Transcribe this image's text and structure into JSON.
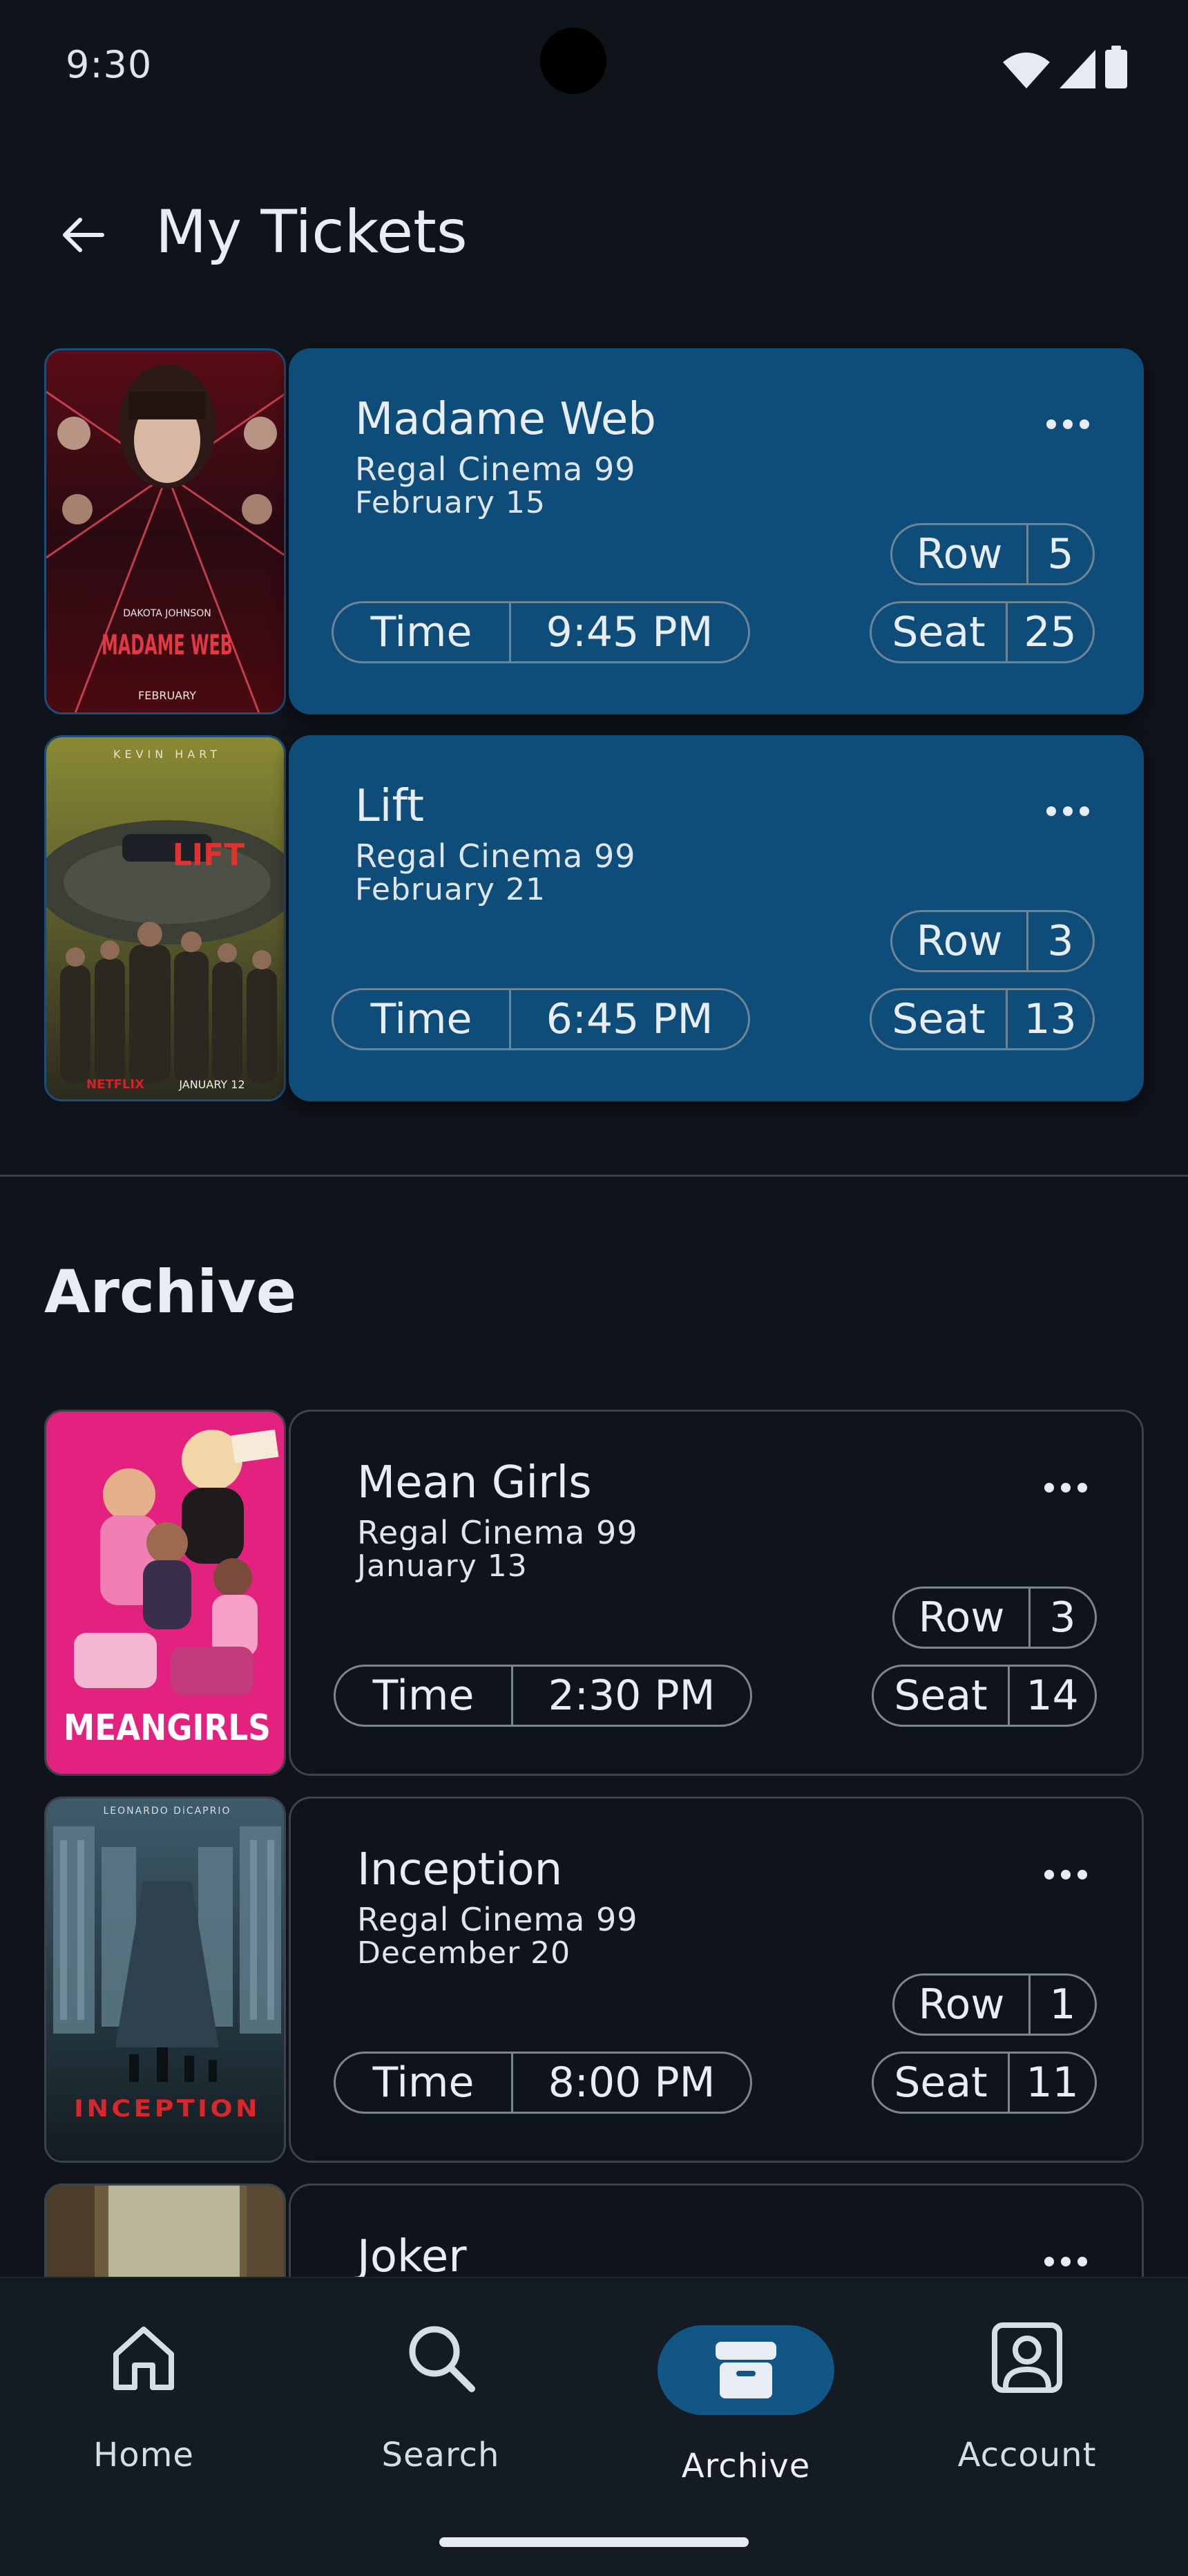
{
  "status_bar": {
    "time": "9:30"
  },
  "header": {
    "title": "My Tickets"
  },
  "labels": {
    "time": "Time",
    "row": "Row",
    "seat": "Seat"
  },
  "tickets": [
    {
      "title": "Madame Web",
      "cinema": "Regal Cinema 99",
      "date": "February 15",
      "time": "9:45 PM",
      "row": "5",
      "seat": "25"
    },
    {
      "title": "Lift",
      "cinema": "Regal Cinema 99",
      "date": "February 21",
      "time": "6:45 PM",
      "row": "3",
      "seat": "13"
    }
  ],
  "archive": {
    "title": "Archive",
    "tickets": [
      {
        "title": "Mean Girls",
        "cinema": "Regal Cinema 99",
        "date": "January 13",
        "time": "2:30 PM",
        "row": "3",
        "seat": "14"
      },
      {
        "title": "Inception",
        "cinema": "Regal Cinema 99",
        "date": "December 20",
        "time": "8:00 PM",
        "row": "1",
        "seat": "11"
      },
      {
        "title": "Joker"
      }
    ]
  },
  "posters": {
    "madame_web": {
      "line1": "DAKOTA JOHNSON",
      "title": "MADAME WEB",
      "month": "FEBRUARY"
    },
    "lift": {
      "top": "KEVIN HART",
      "title": "LIFT",
      "brand": "NETFLIX",
      "date": "JANUARY 12"
    },
    "mean_girls": {
      "title": "MEANGIRLS"
    },
    "inception": {
      "top": "LEONARDO DiCAPRIO",
      "title": "INCEPTION"
    }
  },
  "nav": {
    "items": [
      {
        "label": "Home",
        "icon": "home-icon"
      },
      {
        "label": "Search",
        "icon": "search-icon"
      },
      {
        "label": "Archive",
        "icon": "archive-icon"
      },
      {
        "label": "Account",
        "icon": "account-icon"
      }
    ],
    "active": "Archive"
  },
  "colors": {
    "background": "#0f141b",
    "active_card": "#0e4d79",
    "nav_active": "#115684",
    "text": "#e8edf3"
  }
}
